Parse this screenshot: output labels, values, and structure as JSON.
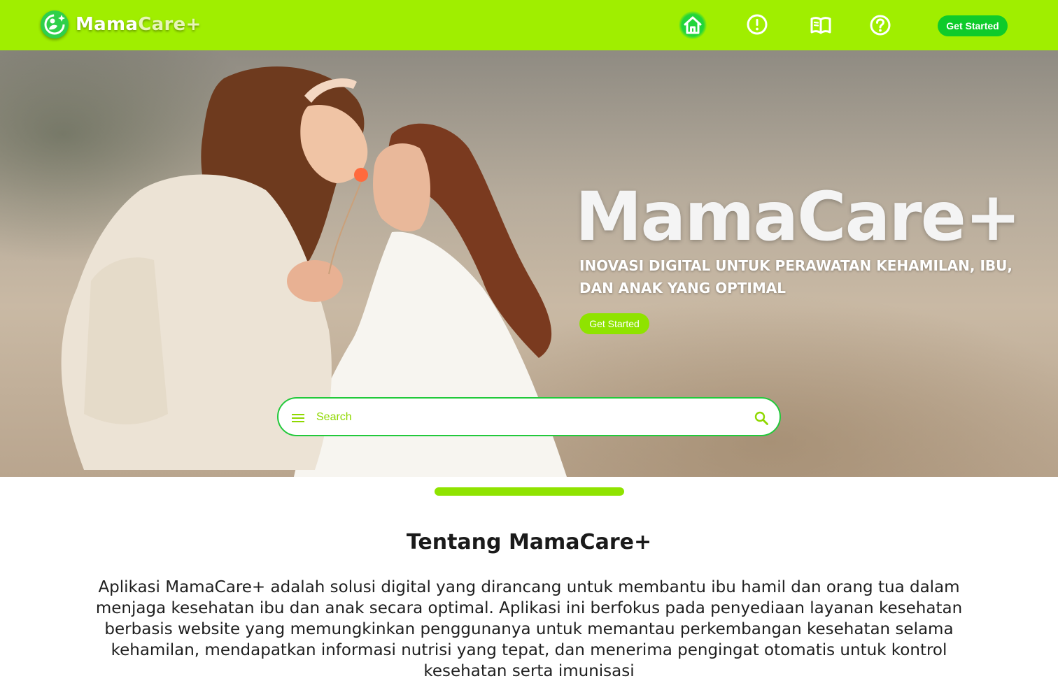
{
  "brand": {
    "part1": "Mama",
    "part2": "Care+"
  },
  "nav": {
    "items": [
      {
        "icon": "home-icon",
        "active": true
      },
      {
        "icon": "alert-icon",
        "active": false
      },
      {
        "icon": "book-icon",
        "active": false
      },
      {
        "icon": "help-icon",
        "active": false
      }
    ],
    "cta_label": "Get Started"
  },
  "hero": {
    "title": "MamaCare+",
    "subtitle": "INOVASI DIGITAL UNTUK PERAWATAN KEHAMILAN, IBU, DAN ANAK YANG OPTIMAL",
    "cta_label": "Get Started"
  },
  "search": {
    "placeholder": "Search",
    "value": ""
  },
  "about": {
    "title": "Tentang MamaCare+",
    "body": "Aplikasi MamaCare+ adalah solusi digital yang dirancang untuk membantu ibu hamil dan orang tua dalam menjaga kesehatan ibu dan anak secara optimal. Aplikasi ini berfokus pada penyediaan layanan kesehatan berbasis website yang memungkinkan penggunanya untuk memantau perkembangan kesehatan selama kehamilan, mendapatkan informasi nutrisi yang tepat, dan menerima pengingat otomatis untuk kontrol kesehatan serta imunisasi"
  },
  "colors": {
    "navbar": "#a0ee00",
    "accent_green": "#0ecb2a",
    "lime": "#8fe300"
  }
}
